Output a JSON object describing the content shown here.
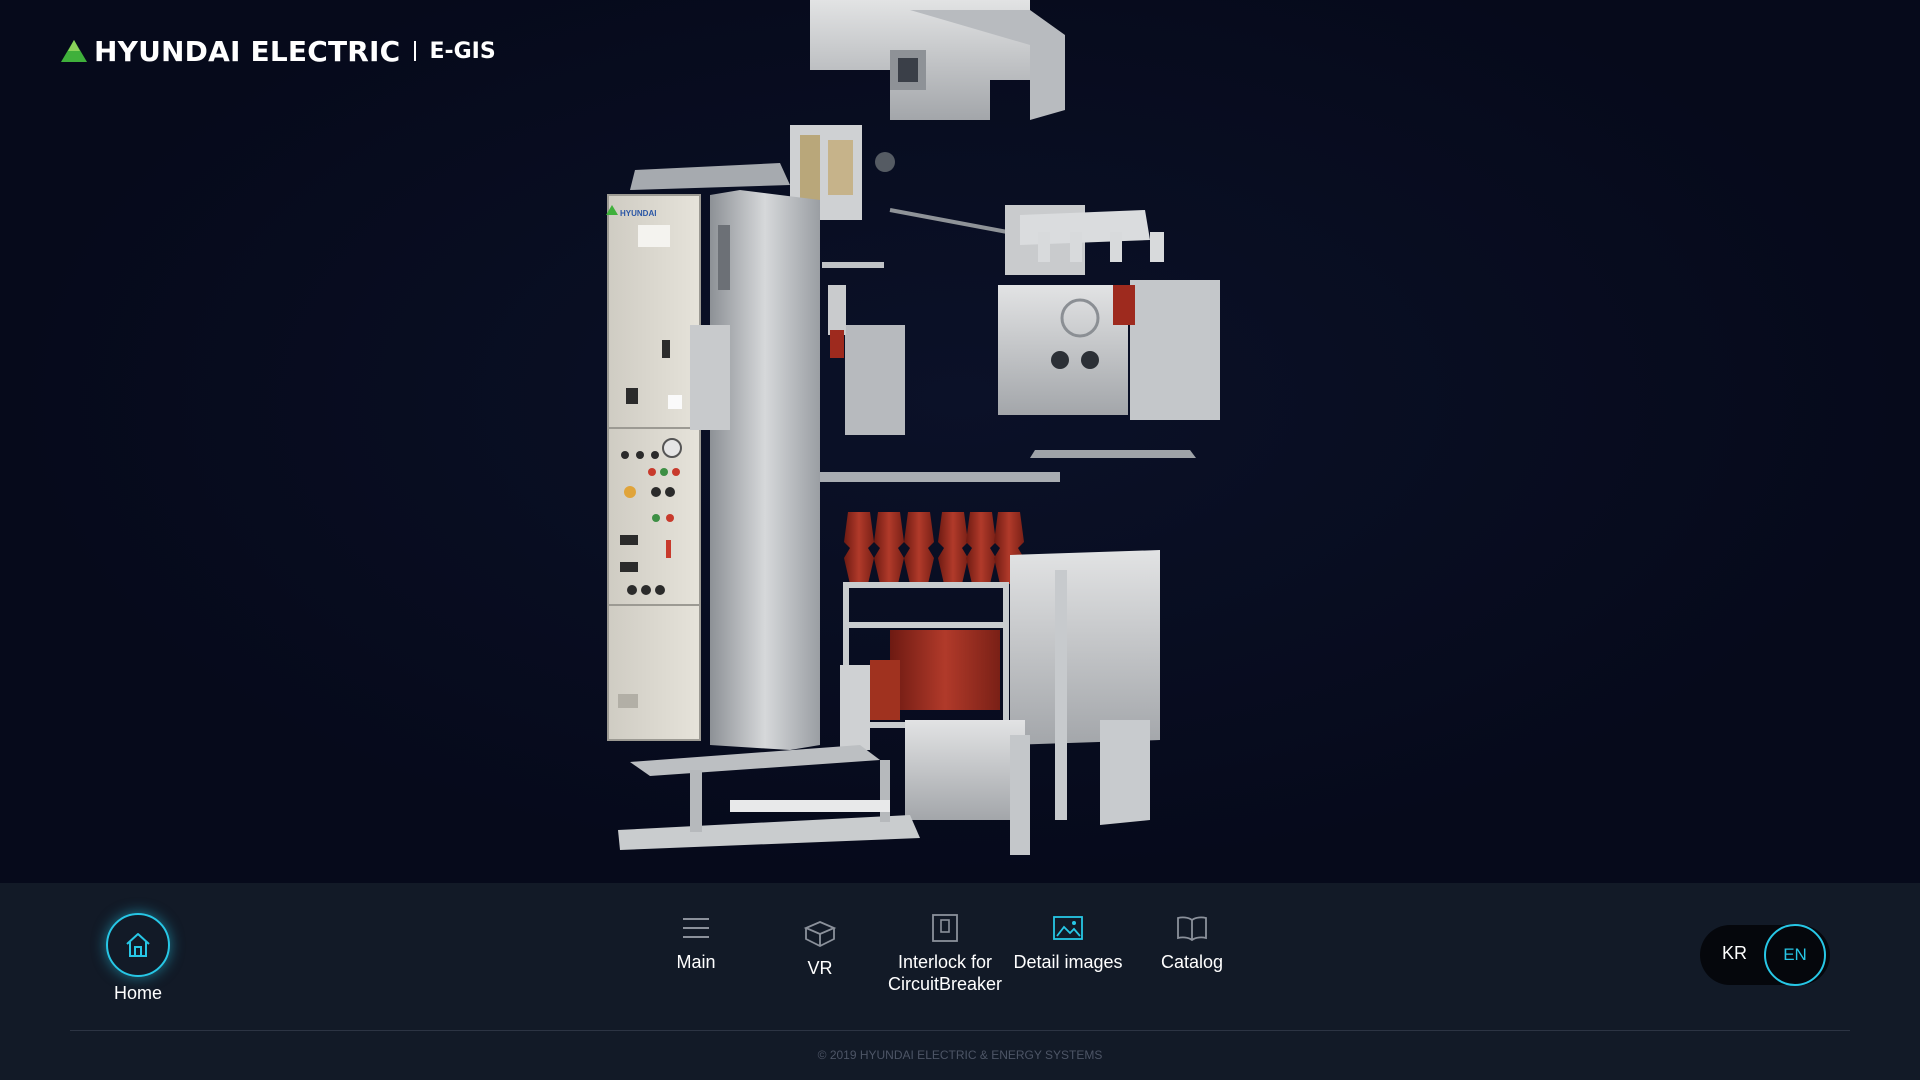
{
  "header": {
    "brand": "HYUNDAI ELECTRIC",
    "product": "E-GIS",
    "brand_color": "#3fb03b"
  },
  "product_image": {
    "panel_badge_text": "HYUNDAI"
  },
  "nav": {
    "home_label": "Home",
    "items": [
      {
        "label": "Main",
        "icon": "hamburger-menu-icon"
      },
      {
        "label": "VR",
        "icon": "cube-icon"
      },
      {
        "label": "Interlock for",
        "label2": "CircuitBreaker",
        "icon": "panel-icon"
      },
      {
        "label": "Detail images",
        "icon": "image-icon"
      },
      {
        "label": "Catalog",
        "icon": "book-icon"
      }
    ]
  },
  "language": {
    "kr": "KR",
    "en": "EN",
    "active": "EN"
  },
  "footer": {
    "copyright": "© 2019 HYUNDAI ELECTRIC & ENERGY SYSTEMS"
  },
  "colors": {
    "accent": "#27c7e6",
    "background": "#070b1c",
    "bottombar": "#121a27",
    "insulator_red": "#9e2a1e"
  }
}
